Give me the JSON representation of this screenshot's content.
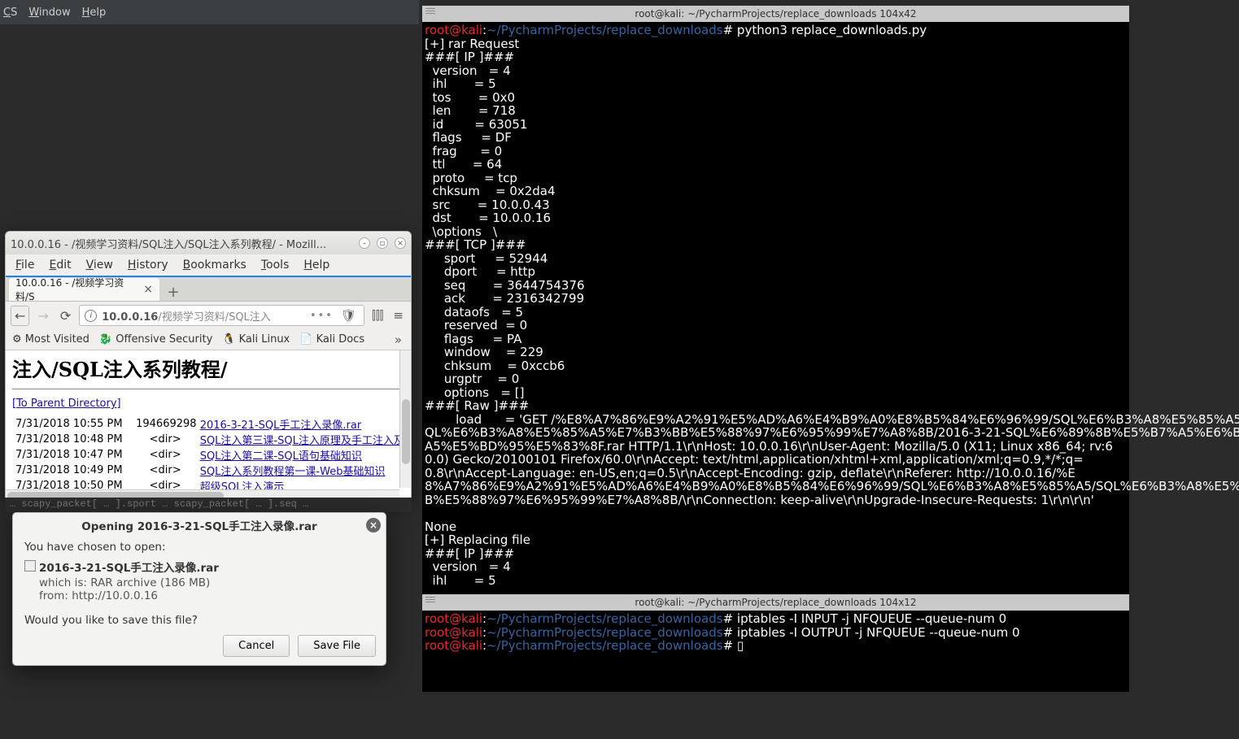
{
  "ide_menubar": [
    "CS",
    "Window",
    "Help"
  ],
  "ide_slice_text": "… scapy_packet[ … ].sport    … scapy_packet[ … ].seq  …",
  "terminal1": {
    "title": "root@kali: ~/PycharmProjects/replace_downloads 104x42",
    "prompt_user": "root@kali",
    "prompt_path": "~/PycharmProjects/replace_downloads",
    "prompt_symbol": "#",
    "command": "python3 replace_downloads.py",
    "body": "[+] rar Request\n###[ IP ]###\n  version   = 4\n  ihl       = 5\n  tos       = 0x0\n  len       = 718\n  id        = 63051\n  flags     = DF\n  frag      = 0\n  ttl       = 64\n  proto     = tcp\n  chksum    = 0x2da4\n  src       = 10.0.0.43\n  dst       = 10.0.0.16\n  \\options   \\\n###[ TCP ]###\n     sport     = 52944\n     dport     = http\n     seq       = 3644754376\n     ack       = 2316342799\n     dataofs   = 5\n     reserved  = 0\n     flags     = PA\n     window    = 229\n     chksum    = 0xccb6\n     urgptr    = 0\n     options   = []\n###[ Raw ]###\n        load      = 'GET /%E8%A7%86%E9%A2%91%E5%AD%A6%E4%B9%A0%E8%B5%84%E6%96%99/SQL%E6%B3%A8%E5%85%A5/S\nQL%E6%B3%A8%E5%85%A5%E7%B3%BB%E5%88%97%E6%95%99%E7%A8%8B/2016-3-21-SQL%E6%89%8B%E5%B7%A5%E6%B3%A8%E5%85%\nA5%E5%BD%95%E5%83%8F.rar HTTP/1.1\\r\\nHost: 10.0.0.16\\r\\nUser-Agent: Mozilla/5.0 (X11; Linux x86_64; rv:6\n0.0) Gecko/20100101 Firefox/60.0\\r\\nAccept: text/html,application/xhtml+xml,application/xml;q=0.9,*/*;q=\n0.8\\r\\nAccept-Language: en-US,en;q=0.5\\r\\nAccept-Encoding: gzip, deflate\\r\\nReferer: http://10.0.0.16/%E\n8%A7%86%E9%A2%91%E5%AD%A6%E4%B9%A0%E8%B5%84%E6%96%99/SQL%E6%B3%A8%E5%85%A5/SQL%E6%B3%A8%E5%85%A5%E7%B3%B\nB%E5%88%97%E6%95%99%E7%A8%8B/\\r\\nConnectIon: keep-alive\\r\\nUpgrade-Insecure-Requests: 1\\r\\n\\r\\n'\n\nNone\n[+] Replacing file\n###[ IP ]###\n  version   = 4\n  ihl       = 5"
  },
  "terminal2": {
    "title": "root@kali: ~/PycharmProjects/replace_downloads 104x12",
    "lines": [
      {
        "user": "root@kali",
        "path": "~/PycharmProjects/replace_downloads",
        "cmd": "iptables -I INPUT -j NFQUEUE --queue-num 0"
      },
      {
        "user": "root@kali",
        "path": "~/PycharmProjects/replace_downloads",
        "cmd": "iptables -I OUTPUT -j NFQUEUE --queue-num 0"
      },
      {
        "user": "root@kali",
        "path": "~/PycharmProjects/replace_downloads",
        "cmd": "▯"
      }
    ]
  },
  "firefox": {
    "window_title": "10.0.0.16 - /视频学习资料/SQL注入/SQL注入系列教程/ - Mozill...",
    "menubar": [
      "File",
      "Edit",
      "View",
      "History",
      "Bookmarks",
      "Tools",
      "Help"
    ],
    "tab_label": "10.0.0.16 - /视频学习资料/S",
    "url_display_strong": "10.0.0.16",
    "url_display_rest": "/视频学习资料/SQL注入",
    "bookmarks": [
      "Most Visited",
      "Offensive Security",
      "Kali Linux",
      "Kali Docs"
    ],
    "content_heading": "注入/SQL注入系列教程/",
    "parent_link": "[To Parent Directory]",
    "listing": [
      {
        "date": " 7/31/2018 10:55 PM",
        "size": "    194669298",
        "link": "2016-3-21-SQL手工注入录像.rar"
      },
      {
        "date": " 7/31/2018 10:48 PM",
        "size": "        <dir>",
        "link": "SQL注入第三课-SQL注入原理及手工注入及工具如何配"
      },
      {
        "date": " 7/31/2018 10:47 PM",
        "size": "        <dir>",
        "link": "SQL注入第二课-SQL语句基础知识"
      },
      {
        "date": " 7/31/2018 10:49 PM",
        "size": "        <dir>",
        "link": "SQL注入系列教程第一课-Web基础知识"
      },
      {
        "date": " 7/31/2018 10:50 PM",
        "size": "        <dir>",
        "link": "超级SQL注入演示"
      }
    ]
  },
  "dialog": {
    "title": "Opening 2016-3-21-SQL手工注入录像.rar",
    "line1": "You have chosen to open:",
    "filename": "2016-3-21-SQL手工注入录像.rar",
    "which_is": "which is:  RAR archive (186 MB)",
    "from": "from:  http://10.0.0.16",
    "question": "Would you like to save this file?",
    "cancel": "Cancel",
    "save": "Save File"
  }
}
